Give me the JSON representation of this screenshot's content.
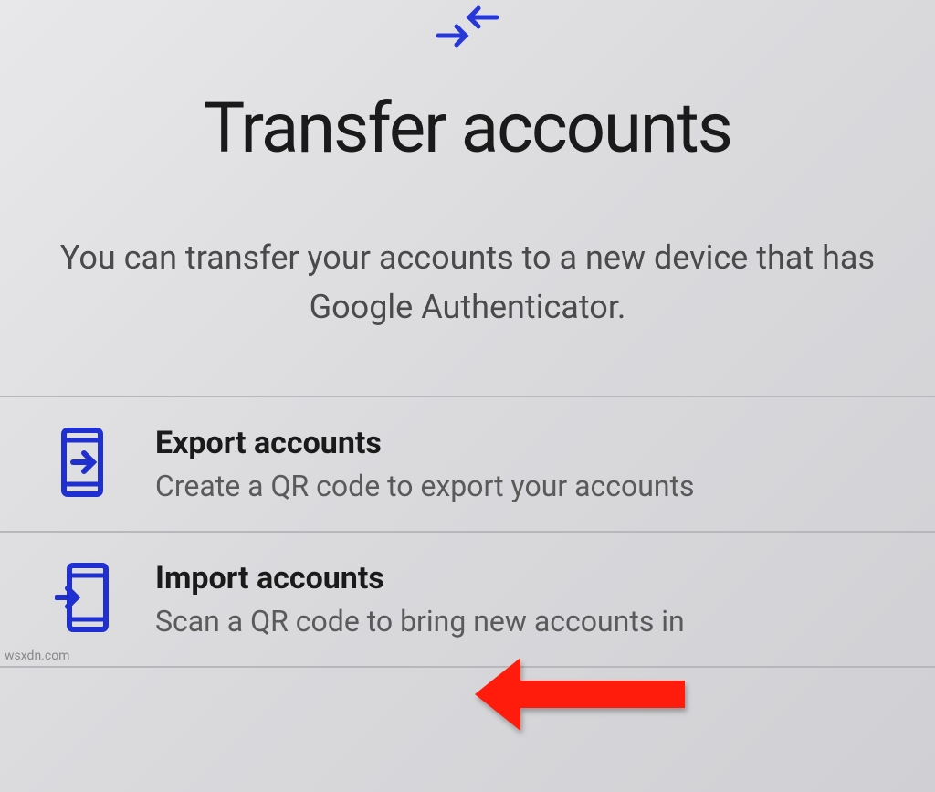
{
  "header": {
    "icon_name": "transfer-arrows-icon",
    "title": "Transfer accounts",
    "description": "You can transfer your accounts to a new device that has Google Authenticator."
  },
  "options": [
    {
      "icon": "phone-export-icon",
      "title": "Export accounts",
      "subtitle": "Create a QR code to export your accounts"
    },
    {
      "icon": "phone-import-icon",
      "title": "Import accounts",
      "subtitle": "Scan a QR code to bring new accounts in"
    }
  ],
  "annotation": {
    "type": "red-arrow",
    "points_to": "Import accounts"
  },
  "watermark": "wsxdn.com"
}
